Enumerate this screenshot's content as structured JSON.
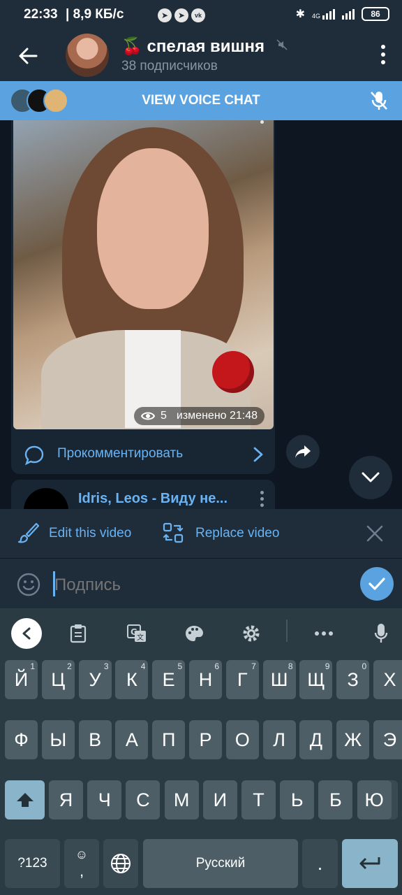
{
  "status_bar": {
    "time": "22:33",
    "speed": "| 8,9 КБ/с",
    "network": "4G",
    "battery": "86"
  },
  "header": {
    "title": "🍒 спелая вишня",
    "subtitle": "38 подписчиков"
  },
  "voice_chat": {
    "label": "VIEW VOICE CHAT"
  },
  "post": {
    "views": "5",
    "edited": "изменено 21:48",
    "comment_label": "Прокомментировать"
  },
  "next_post": {
    "title": "Idris, Leos - Виду не..."
  },
  "edit_bar": {
    "edit_label": "Edit this video",
    "replace_label": "Replace video"
  },
  "input": {
    "placeholder": "Подпись"
  },
  "keyboard": {
    "row1": [
      {
        "key": "Й",
        "hint": "1"
      },
      {
        "key": "Ц",
        "hint": "2"
      },
      {
        "key": "У",
        "hint": "3"
      },
      {
        "key": "К",
        "hint": "4"
      },
      {
        "key": "Е",
        "hint": "5"
      },
      {
        "key": "Н",
        "hint": "6"
      },
      {
        "key": "Г",
        "hint": "7"
      },
      {
        "key": "Ш",
        "hint": "8"
      },
      {
        "key": "Щ",
        "hint": "9"
      },
      {
        "key": "З",
        "hint": "0"
      },
      {
        "key": "Х",
        "hint": ""
      }
    ],
    "row2": [
      "Ф",
      "Ы",
      "В",
      "А",
      "П",
      "Р",
      "О",
      "Л",
      "Д",
      "Ж",
      "Э"
    ],
    "row3": [
      "Я",
      "Ч",
      "С",
      "М",
      "И",
      "Т",
      "Ь",
      "Б",
      "Ю"
    ],
    "sym_label": "?123",
    "emoji_label": "☺",
    "comma": ",",
    "space_label": "Русский",
    "period": "."
  },
  "colors": {
    "accent": "#5aa3e0",
    "link": "#6ab3f3",
    "header_bg": "#1f2c3a",
    "chat_bg": "#0e1621",
    "keyboard_bg": "#2b3b43"
  }
}
